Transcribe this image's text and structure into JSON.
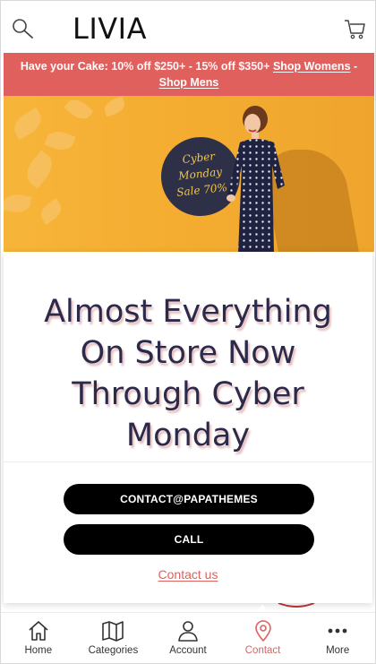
{
  "header": {
    "logo": "LIVIA",
    "search_icon": "search-icon",
    "cart_icon": "cart-icon"
  },
  "promo": {
    "lead": "Have your Cake:",
    "offer": "10% off $250+ -  15% off $350+",
    "link_women": "Shop Womens",
    "separator": "-",
    "link_men": "Shop Mens",
    "color": "#e0605e"
  },
  "hero": {
    "badge_line1": "Cyber",
    "badge_line2": "Monday",
    "badge_line3": "Sale 70%"
  },
  "main": {
    "headline_l1": "Almost Everything",
    "headline_l2": "On Store Now",
    "headline_l3": "Through Cyber",
    "headline_l4": "Monday",
    "email_button": "CONTACT@PAPATHEMES",
    "call_button": "CALL",
    "contact_link": "Contact us"
  },
  "nav": {
    "items": [
      {
        "label": "Home",
        "icon": "home-icon"
      },
      {
        "label": "Categories",
        "icon": "map-icon"
      },
      {
        "label": "Account",
        "icon": "user-icon"
      },
      {
        "label": "Contact",
        "icon": "location-pin-icon"
      },
      {
        "label": "More",
        "icon": "more-dots-icon"
      }
    ],
    "active_index": 3,
    "active_color": "#e0605e"
  }
}
